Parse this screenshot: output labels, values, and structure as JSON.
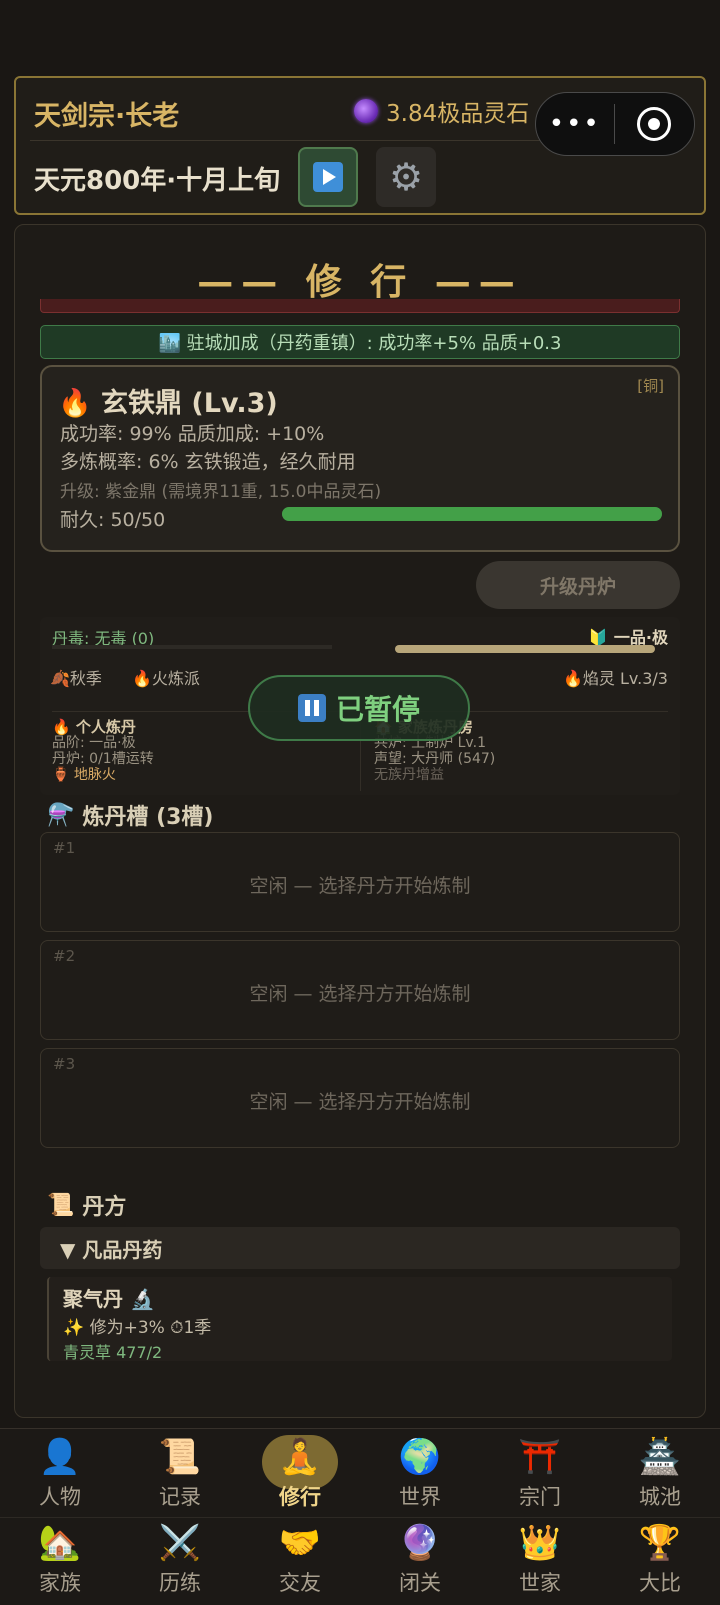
{
  "header": {
    "sect_title": "天剑宗·长老",
    "spirit_stones": "3.84极品灵石",
    "date": "天元800年·十月上旬",
    "menu_dots": "•••"
  },
  "panel": {
    "title": "—— 修 行 ——",
    "city_bonus": "🏙️ 驻城加成（丹药重镇）: 成功率+5% 品质+0.3",
    "furnace": {
      "name": "🔥 玄铁鼎 (Lv.3)",
      "tier_tag": "[铜]",
      "line1": "成功率: 99%  品质加成: +10%",
      "line2": "多炼概率: 6%  玄铁锻造，经久耐用",
      "upgrade_hint": "升级: 紫金鼎 (需境界11重, 15.0中品灵石)",
      "durability_label": "耐久: 50/50",
      "durability_fraction": 1.0
    },
    "upgrade_button": "升级丹炉",
    "status": {
      "poison": "丹毒: 无毒 (0)",
      "grade": "🔰 一品·极",
      "season": "🍂秋季",
      "school": "🔥火炼派",
      "flame_spirit": "🔥焰灵 Lv.3/3",
      "personal": {
        "head": "🔥 个人炼丹",
        "grade": "品阶: 一品·极",
        "furnace": "丹炉: 0/1槽运转",
        "fire": "🏺 地脉火"
      },
      "family": {
        "head": "🏠 家族炼丹房",
        "furnace": "共炉: 土制炉 Lv.1",
        "fame": "声望: 大丹师 (547)",
        "note": "无族丹增益"
      }
    },
    "paused_label": "已暂停",
    "slots_title": "炼丹槽 (3槽)",
    "slots_icon": "⚗️",
    "slots": [
      {
        "no": "#1",
        "text": "空闲 — 选择丹方开始炼制"
      },
      {
        "no": "#2",
        "text": "空闲 — 选择丹方开始炼制"
      },
      {
        "no": "#3",
        "text": "空闲 — 选择丹方开始炼制"
      }
    ],
    "recipes_title": "丹方",
    "recipes_icon": "📜",
    "category": "▼ 凡品丹药",
    "recipe": {
      "name": "聚气丹 🔬",
      "effect": "✨ 修为+3%  ⏱1季",
      "herb": "青灵草 477/2"
    }
  },
  "nav": {
    "row1": [
      {
        "icon": "👤",
        "label": "人物"
      },
      {
        "icon": "📜",
        "label": "记录"
      },
      {
        "icon": "🧘",
        "label": "修行"
      },
      {
        "icon": "🌍",
        "label": "世界"
      },
      {
        "icon": "⛩️",
        "label": "宗门"
      },
      {
        "icon": "🏯",
        "label": "城池"
      }
    ],
    "row2": [
      {
        "icon": "🏡",
        "label": "家族"
      },
      {
        "icon": "⚔️",
        "label": "历练"
      },
      {
        "icon": "🤝",
        "label": "交友"
      },
      {
        "icon": "🔮",
        "label": "闭关"
      },
      {
        "icon": "👑",
        "label": "世家"
      },
      {
        "icon": "🏆",
        "label": "大比"
      }
    ]
  }
}
